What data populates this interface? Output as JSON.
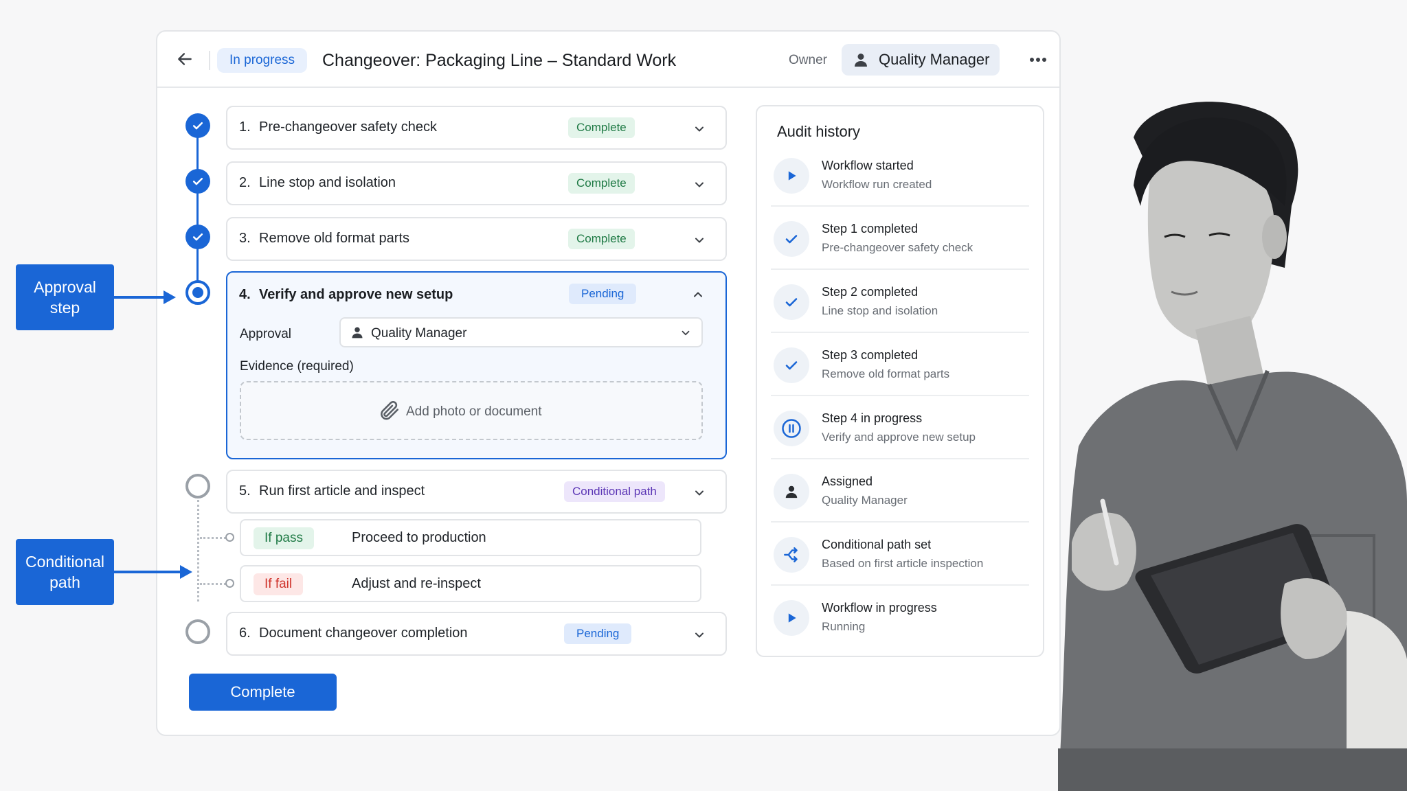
{
  "header": {
    "status": "In progress",
    "title": "Changeover:  Packaging Line – Standard Work",
    "owner_label": "Owner",
    "owner_name": "Quality Manager"
  },
  "steps": [
    {
      "num": "1.",
      "label": "Pre-changeover safety check",
      "status": "Complete"
    },
    {
      "num": "2.",
      "label": "Line stop and isolation",
      "status": "Complete"
    },
    {
      "num": "3.",
      "label": "Remove old format parts",
      "status": "Complete"
    },
    {
      "num": "4.",
      "label": "Verify and approve new setup",
      "status": "Pending",
      "approval_label": "Approval",
      "approver": "Quality Manager",
      "evidence_label": "Evidence (required)",
      "upload_text": "Add photo or document"
    },
    {
      "num": "5.",
      "label": "Run first article and inspect",
      "status": "Conditional path",
      "branches": [
        {
          "condition": "If pass",
          "action": "Proceed to production"
        },
        {
          "condition": "If fail",
          "action": "Adjust and re-inspect"
        }
      ]
    },
    {
      "num": "6.",
      "label": "Document changeover completion",
      "status": "Pending"
    }
  ],
  "complete_button": "Complete",
  "audit": {
    "title": "Audit history",
    "items": [
      {
        "icon": "play-icon",
        "title": "Workflow started",
        "detail": "Workflow run created"
      },
      {
        "icon": "check-icon",
        "title": "Step 1 completed",
        "detail": "Pre-changeover safety check"
      },
      {
        "icon": "check-icon",
        "title": "Step 2 completed",
        "detail": "Line stop and isolation"
      },
      {
        "icon": "check-icon",
        "title": "Step 3 completed",
        "detail": "Remove old format parts"
      },
      {
        "icon": "pause-icon",
        "title": "Step 4 in progress",
        "detail": "Verify and approve new setup"
      },
      {
        "icon": "person-icon",
        "title": "Assigned",
        "detail": "Quality Manager"
      },
      {
        "icon": "branch-icon",
        "title": "Conditional path set",
        "detail": "Based on first article inspection"
      },
      {
        "icon": "play-icon",
        "title": "Workflow in progress",
        "detail": "Running"
      }
    ]
  },
  "callouts": {
    "approval": "Approval step",
    "conditional": "Conditional path"
  },
  "colors": {
    "accent": "#1a66d6",
    "complete_badge": "#1f7a45",
    "conditional_badge": "#5b35b5",
    "fail": "#d0342c"
  }
}
